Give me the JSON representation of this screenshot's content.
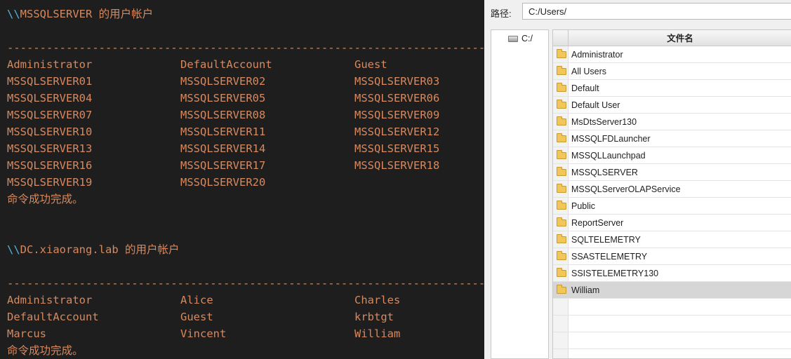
{
  "terminal": {
    "blocks": [
      {
        "header_prefix": "\\\\",
        "header_text": "MSSQLSERVER 的用户帐户",
        "separator": "-------------------------------------------------------------------------------",
        "users": [
          [
            "Administrator",
            "DefaultAccount",
            "Guest"
          ],
          [
            "MSSQLSERVER01",
            "MSSQLSERVER02",
            "MSSQLSERVER03"
          ],
          [
            "MSSQLSERVER04",
            "MSSQLSERVER05",
            "MSSQLSERVER06"
          ],
          [
            "MSSQLSERVER07",
            "MSSQLSERVER08",
            "MSSQLSERVER09"
          ],
          [
            "MSSQLSERVER10",
            "MSSQLSERVER11",
            "MSSQLSERVER12"
          ],
          [
            "MSSQLSERVER13",
            "MSSQLSERVER14",
            "MSSQLSERVER15"
          ],
          [
            "MSSQLSERVER16",
            "MSSQLSERVER17",
            "MSSQLSERVER18"
          ],
          [
            "MSSQLSERVER19",
            "MSSQLSERVER20",
            ""
          ]
        ],
        "footer": "命令成功完成。"
      },
      {
        "header_prefix": "\\\\",
        "header_text": "DC.xiaorang.lab 的用户帐户",
        "separator": "-------------------------------------------------------------------------------",
        "users": [
          [
            "Administrator",
            "Alice",
            "Charles"
          ],
          [
            "DefaultAccount",
            "Guest",
            "krbtgt"
          ],
          [
            "Marcus",
            "Vincent",
            "William"
          ]
        ],
        "footer": "命令成功完成。"
      }
    ]
  },
  "browser": {
    "path_label": "路径:",
    "path_value": "C:/Users/",
    "tree": {
      "drive_label": "C:/",
      "icon": "drive-icon"
    },
    "column_header": "文件名",
    "files": [
      "Administrator",
      "All Users",
      "Default",
      "Default User",
      "MsDtsServer130",
      "MSSQLFDLauncher",
      "MSSQLLaunchpad",
      "MSSQLSERVER",
      "MSSQLServerOLAPService",
      "Public",
      "ReportServer",
      "SQLTELEMETRY",
      "SSASTELEMETRY",
      "SSISTELEMETRY130",
      "William"
    ],
    "selected_file": "William",
    "empty_rows": 4,
    "folder_icon": "folder-icon",
    "colors": {
      "folder": "#f2c75a",
      "selected_row": "#d6d6d6"
    }
  },
  "colors": {
    "terminal_bg": "#1e1e1e",
    "terminal_text": "#d7895f",
    "terminal_prefix": "#55b3d6"
  }
}
